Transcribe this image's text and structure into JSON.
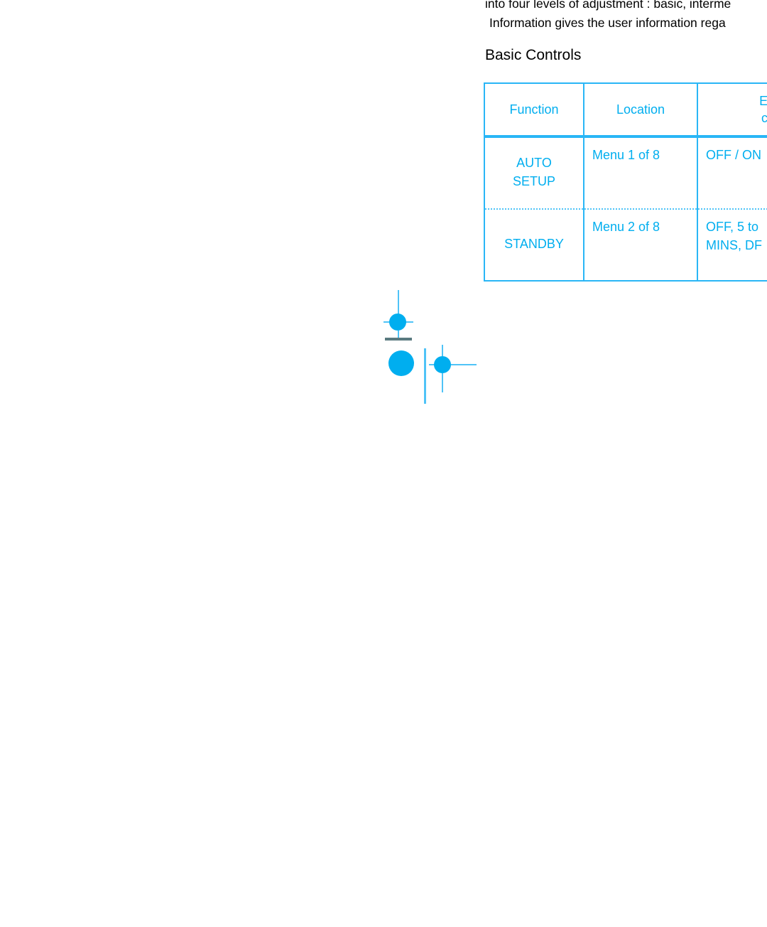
{
  "document": {
    "paragraph_lines": [
      "into four levels of adjustment : basic, interme",
      "Information  gives the user information rega"
    ],
    "section_heading": "Basic Controls"
  },
  "table": {
    "columns": [
      {
        "key": "function",
        "header": [
          "Function"
        ]
      },
      {
        "key": "location",
        "header": [
          "Location"
        ]
      },
      {
        "key": "effect",
        "header": [
          "Effect",
          "contr"
        ]
      }
    ],
    "rows": [
      {
        "function": [
          "AUTO",
          "SETUP"
        ],
        "location": [
          "Menu 1 of 8"
        ],
        "effect": [
          "OFF / ON"
        ]
      },
      {
        "function": [
          "STANDBY"
        ],
        "location": [
          "Menu 2 of 8"
        ],
        "effect": [
          "OFF, 5 to",
          "MINS, DF"
        ]
      }
    ]
  },
  "colors": {
    "accent_cyan": "#00AEEF",
    "border_cyan": "#29B6F6",
    "dotted_cyan": "#5FC9F8",
    "bar_dark": "#5A7A80",
    "text_black": "#000000",
    "page_background": "#FFFFFF"
  },
  "graphic": {
    "name": "registration-marks",
    "elements": [
      "crosshair-dot-upper",
      "dark-rule-bar",
      "large-solid-dot",
      "tall-vertical-rule",
      "crosshair-dot-right"
    ]
  }
}
